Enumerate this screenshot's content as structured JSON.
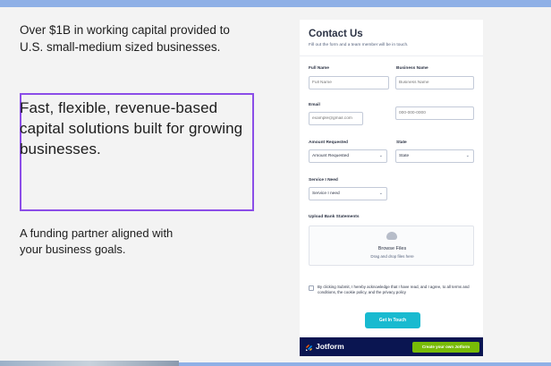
{
  "left": {
    "intro": "Over $1B in working capital provided to U.S. small-medium sized businesses.",
    "headline": "Fast, flexible, revenue-based capital solutions built for growing businesses.",
    "tagline": "A funding partner aligned with your business goals."
  },
  "form": {
    "title": "Contact Us",
    "subtitle": "Fill out the form and a team member will be in touch.",
    "full_name_label": "Full Name",
    "full_name_placeholder": "Full Name",
    "business_name_label": "Business Name",
    "business_name_placeholder": "Business Name",
    "email_label": "Email",
    "email_placeholder": "example@gmail.com",
    "phone_placeholder": "000-000-0000",
    "amount_label": "Amount Requested",
    "amount_value": "Amount Requested",
    "state_label": "State",
    "state_value": "State",
    "service_label": "Service I Need",
    "service_value": "Service I need",
    "upload_label": "Upload Bank Statements",
    "upload_title": "Browse Files",
    "upload_sub": "Drag and drop files here",
    "consent": "By clicking Submit, I hereby acknowledge that I have read, and I agree, to all terms and conditions, the cookie policy, and the privacy policy",
    "submit_label": "Get In Touch"
  },
  "jotform": {
    "name": "Jotform",
    "cta": "Create your own Jotform",
    "logo_colors": [
      "#ff6100",
      "#ffb629",
      "#0099ff",
      "#0a1551"
    ]
  },
  "colors": {
    "highlight": "#8b4de8",
    "submit": "#18bad0",
    "jotform_bar": "#0a1551",
    "jotform_cta": "#78bb07"
  }
}
